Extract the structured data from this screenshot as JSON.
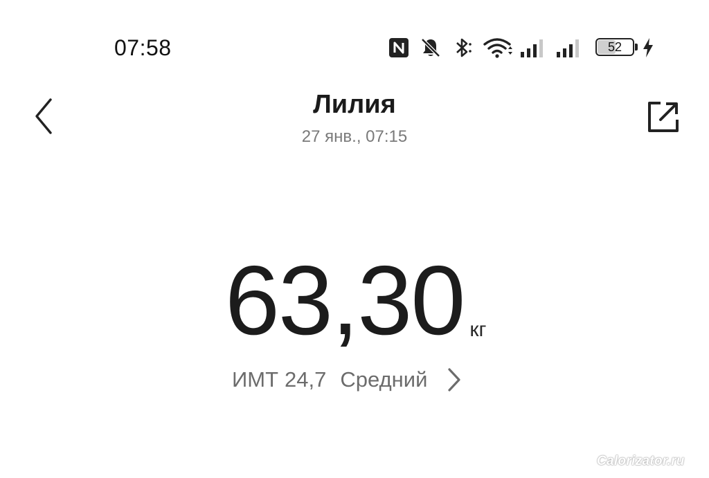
{
  "status_bar": {
    "time": "07:58",
    "battery_level": "52",
    "battery_fraction": 0.52,
    "icons": [
      "nfc-icon",
      "mute-bell-icon",
      "bluetooth-icon",
      "wifi-icon",
      "signal-icon",
      "signal-icon",
      "battery-icon",
      "charging-icon"
    ]
  },
  "header": {
    "title": "Лилия",
    "subtitle": "27 янв., 07:15",
    "back_icon": "chevron-left-icon",
    "share_icon": "share-icon"
  },
  "measurement": {
    "weight": "63,30",
    "unit": "кг"
  },
  "bmi": {
    "label": "ИМТ",
    "value": "24,7",
    "status": "Средний",
    "chevron_icon": "chevron-right-icon"
  },
  "watermark": {
    "text": "Calorizator.ru"
  },
  "colors": {
    "background": "#ffffff",
    "text_primary": "#1b1b1b",
    "text_secondary": "#7a7a7a",
    "bmi_text": "#6c6c6c"
  }
}
